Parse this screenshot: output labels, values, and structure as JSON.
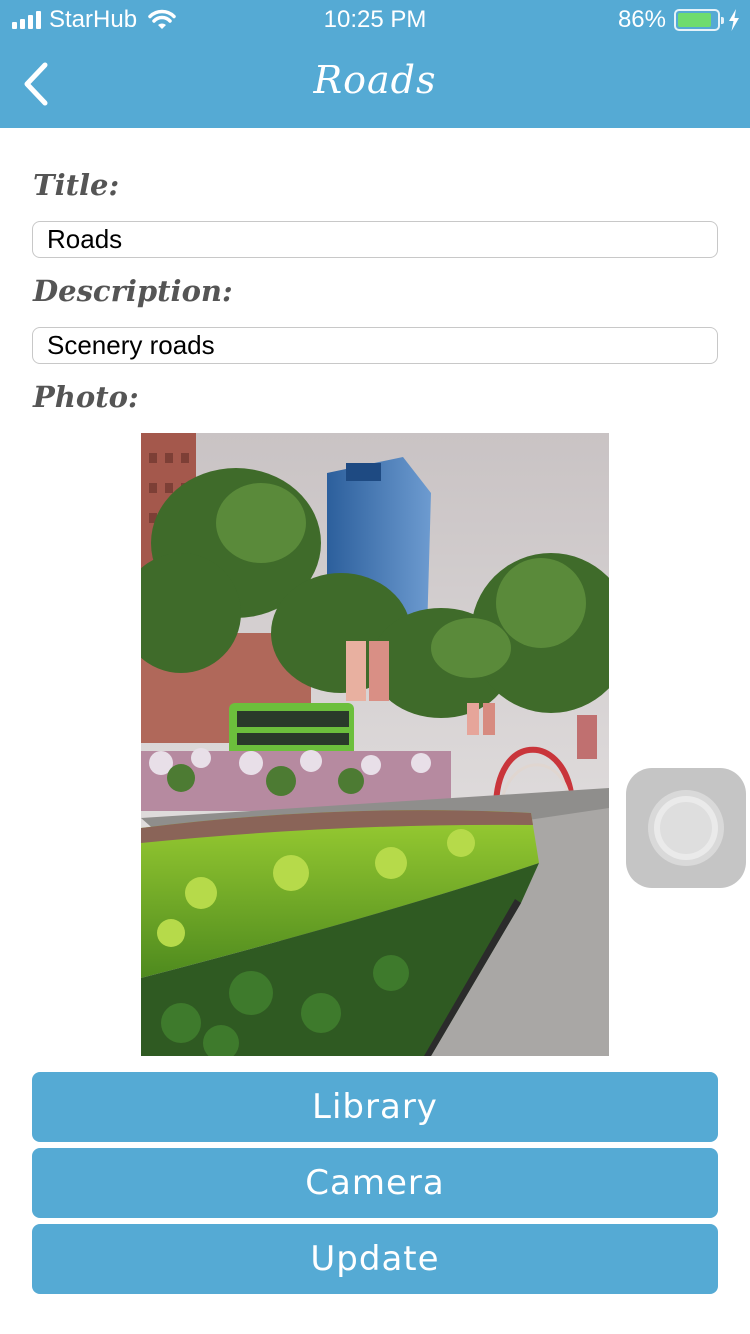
{
  "status_bar": {
    "carrier": "StarHub",
    "time": "10:25 PM",
    "battery": "86%",
    "battery_level": 0.86,
    "icons": [
      "signal-icon",
      "wifi-icon",
      "battery-icon",
      "charging-bolt-icon"
    ]
  },
  "nav": {
    "title": "Roads",
    "back_icon": "chevron-left-icon"
  },
  "form": {
    "title_label": "Title:",
    "title_value": "Roads",
    "description_label": "Description:",
    "description_value": "Scenery roads",
    "photo_label": "Photo:"
  },
  "buttons": {
    "library": "Library",
    "camera": "Camera",
    "update": "Update"
  },
  "colors": {
    "accent": "#55aad4",
    "label": "#555555"
  }
}
